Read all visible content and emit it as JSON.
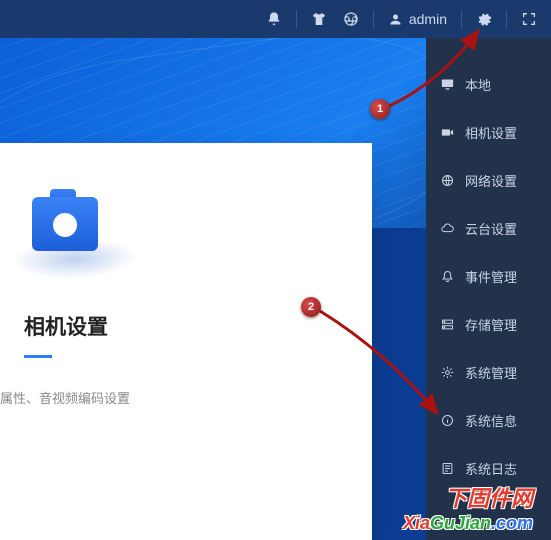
{
  "topbar": {
    "user_label": "admin"
  },
  "card": {
    "title": "相机设置",
    "desc": "属性、音视频编码设置"
  },
  "menu": {
    "items": [
      {
        "label": "本地"
      },
      {
        "label": "相机设置"
      },
      {
        "label": "网络设置"
      },
      {
        "label": "云台设置"
      },
      {
        "label": "事件管理"
      },
      {
        "label": "存储管理"
      },
      {
        "label": "系统管理"
      },
      {
        "label": "系统信息"
      },
      {
        "label": "系统日志"
      }
    ]
  },
  "annotations": {
    "marker1": "1",
    "marker2": "2"
  },
  "watermark": {
    "cn": "下固件网",
    "en_a": "Xia",
    "en_b": "GuJian",
    "en_c": ".com"
  }
}
